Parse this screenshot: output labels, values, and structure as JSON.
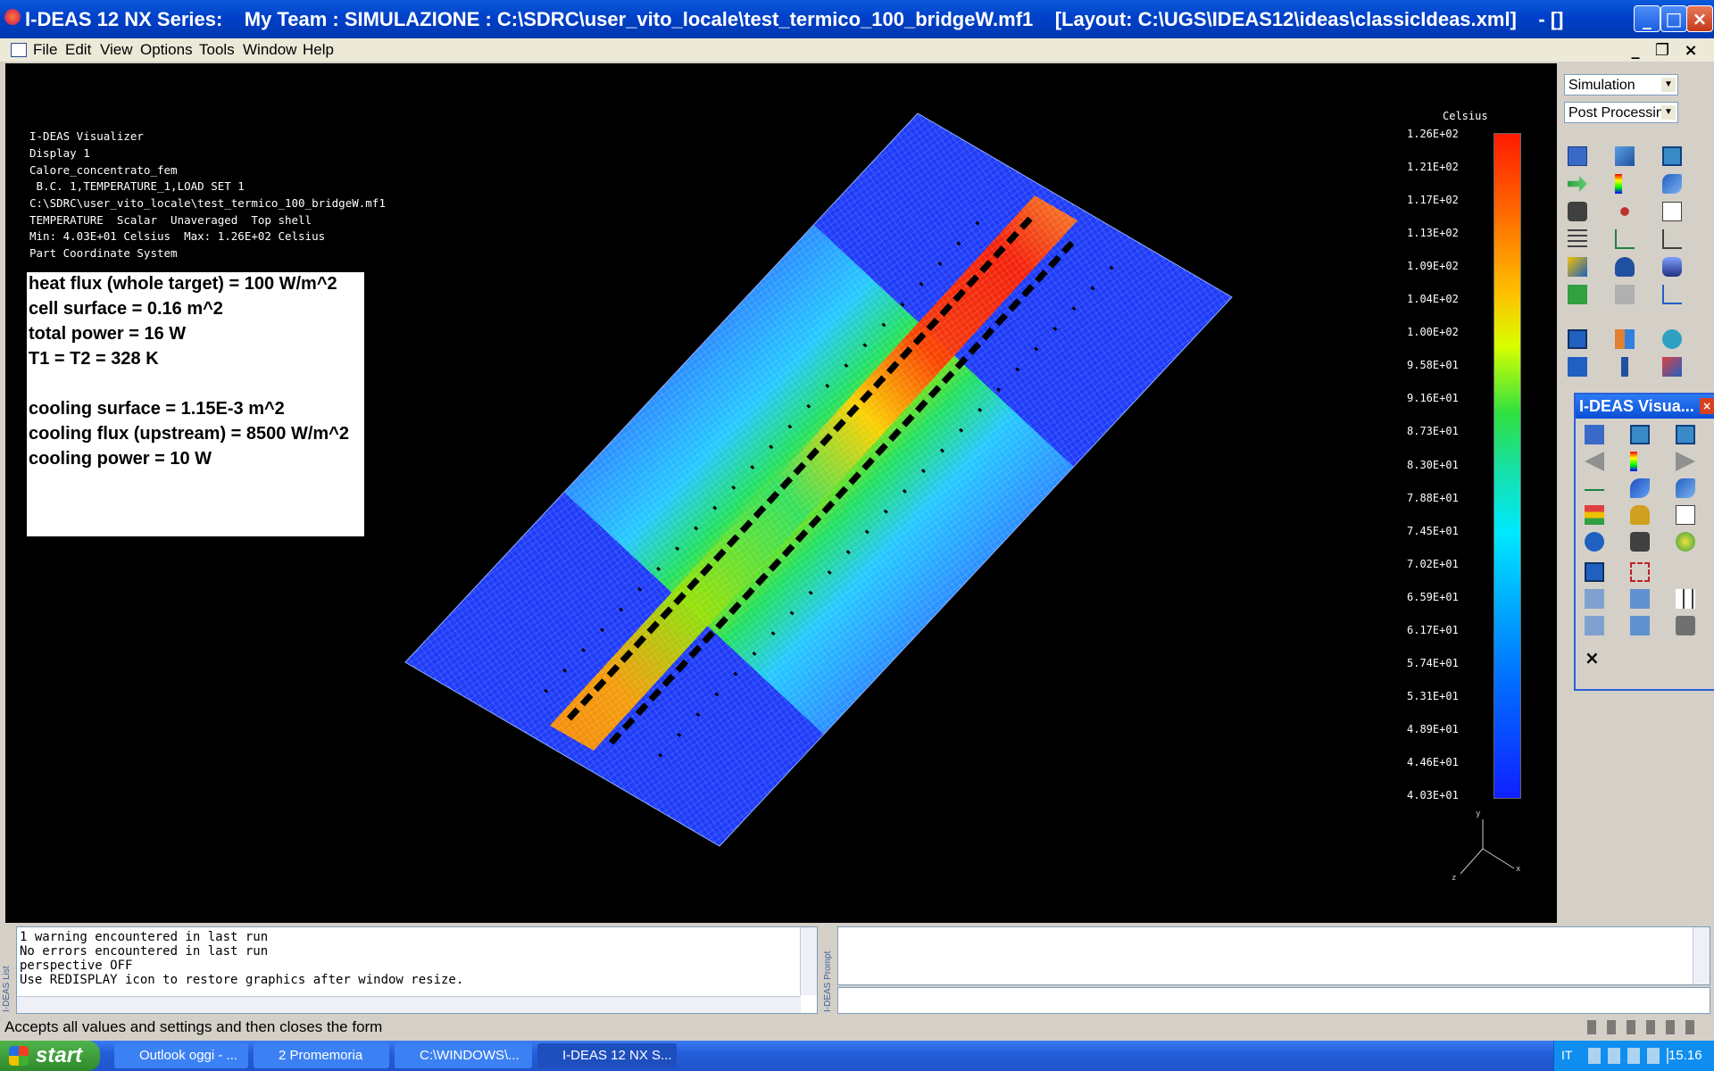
{
  "window": {
    "title": "I-DEAS 12 NX Series:    My Team : SIMULAZIONE : C:\\SDRC\\user_vito_locale\\test_termico_100_bridgeW.mf1    [Layout: C:\\UGS\\IDEAS12\\ideas\\classicIdeas.xml]    - []",
    "minimize": "_",
    "maximize": "□",
    "close": "×"
  },
  "menu": [
    "File",
    "Edit",
    "View",
    "Options",
    "Tools",
    "Window",
    "Help"
  ],
  "mdi_controls": {
    "minimize": "_",
    "restore": "❐",
    "close": "×"
  },
  "viewport": {
    "info_lines": [
      "I-DEAS Visualizer",
      "Display 1",
      "Calore_concentrato_fem",
      " B.C. 1,TEMPERATURE_1,LOAD SET 1",
      "C:\\SDRC\\user_vito_locale\\test_termico_100_bridgeW.mf1",
      "TEMPERATURE  Scalar  Unaveraged  Top shell",
      "Min: 4.03E+01 Celsius  Max: 1.26E+02 Celsius",
      "Part Coordinate System"
    ],
    "notes": [
      "heat flux (whole target) = 100 W/m^2",
      "cell surface = 0.16 m^2",
      "total power = 16 W",
      "T1 = T2 = 328 K",
      "",
      "cooling surface = 1.15E-3 m^2",
      "cooling flux (upstream) = 8500 W/m^2",
      "cooling power = 10 W"
    ],
    "legend": {
      "unit": "Celsius",
      "labels": [
        "1.26E+02",
        "1.21E+02",
        "1.17E+02",
        "1.13E+02",
        "1.09E+02",
        "1.04E+02",
        "1.00E+02",
        "9.58E+01",
        "9.16E+01",
        "8.73E+01",
        "8.30E+01",
        "7.88E+01",
        "7.45E+01",
        "7.02E+01",
        "6.59E+01",
        "6.17E+01",
        "5.74E+01",
        "5.31E+01",
        "4.89E+01",
        "4.46E+01",
        "4.03E+01"
      ]
    },
    "triad": {
      "x": "x",
      "y": "y",
      "z": "z"
    }
  },
  "right_panel": {
    "task_dropdown": "Simulation",
    "subtask_dropdown": "Post Processin",
    "visualizer_title": "I-DEAS Visua..."
  },
  "list_pane": {
    "side_label": "I-DEAS List",
    "lines": [
      "1 warning encountered in last run",
      "No errors encountered in last run",
      "perspective OFF",
      "Use REDISPLAY icon to restore graphics after window resize."
    ]
  },
  "prompt_pane": {
    "side_label": "I-DEAS Prompt",
    "input_value": ""
  },
  "status": "Accepts all values and settings and then closes the form",
  "taskbar": {
    "start": "start",
    "tasks": [
      "Outlook oggi - ...",
      "2 Promemoria",
      "C:\\WINDOWS\\...",
      "I-DEAS 12 NX S..."
    ],
    "lang": "IT",
    "clock": "15.16"
  },
  "colors": {
    "titlebar": "#0040c8",
    "viewport_bg": "#000000",
    "hot": "#ff2000",
    "cold": "#1a1aff"
  }
}
